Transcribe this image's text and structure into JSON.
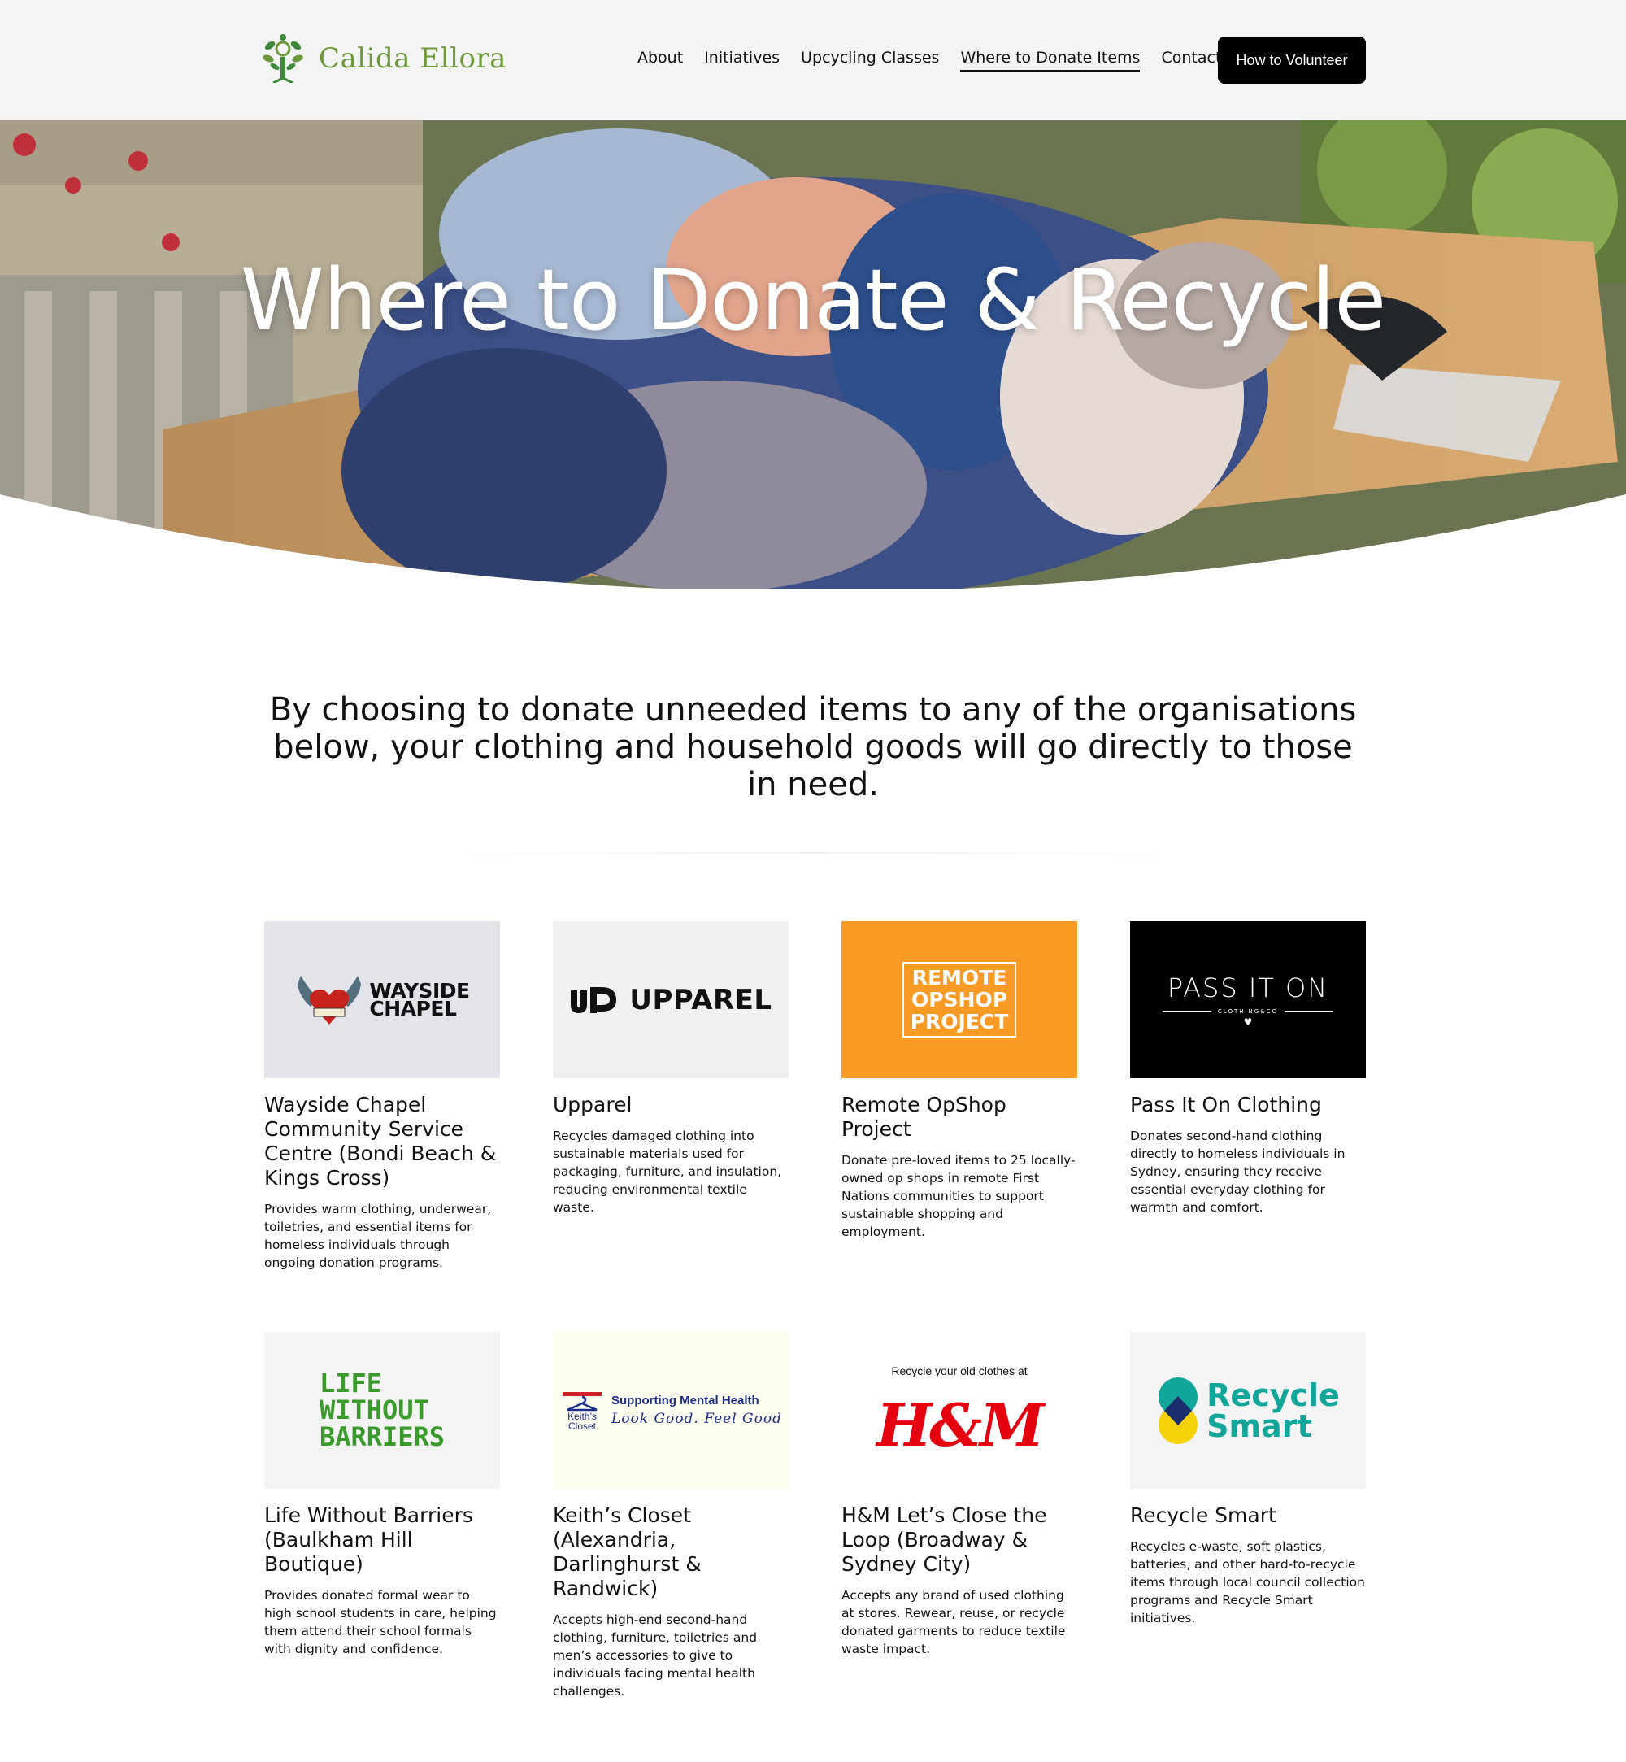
{
  "brand": {
    "name": "Calida Ellora",
    "logo_icon": "tree-icon"
  },
  "nav": {
    "items": [
      {
        "label": "About",
        "active": false
      },
      {
        "label": "Initiatives",
        "active": false
      },
      {
        "label": "Upcycling Classes",
        "active": false
      },
      {
        "label": "Where to Donate Items",
        "active": true
      },
      {
        "label": "Contact Us",
        "active": false
      }
    ],
    "cta_label": "How to Volunteer"
  },
  "hero": {
    "title": "Where to Donate & Recycle"
  },
  "intro": {
    "text": "By choosing to donate unneeded items to any of the organisations below, your clothing and household goods will go directly to those in need."
  },
  "organisations": [
    {
      "name": "Wayside Chapel Community Service Centre (Bondi Beach & Kings Cross)",
      "description": "Provides warm clothing, underwear, toiletries, and essential items for homeless individuals through ongoing donation programs.",
      "logo": {
        "line1": "WAYSIDE",
        "line2": "CHAPEL",
        "bg": "#e3e4ea"
      }
    },
    {
      "name": "Upparel",
      "description": "Recycles damaged clothing into sustainable materials used for packaging, furniture, and insulation, reducing environmental textile waste.",
      "logo": {
        "text": "UPPAREL",
        "bg": "#f0f0f0"
      }
    },
    {
      "name": "Remote OpShop Project",
      "description": "Donate pre-loved items to 25 locally-owned op shops in remote First Nations communities to support sustainable shopping and employment.",
      "logo": {
        "line1": "REMOTE",
        "line2": "OPSHOP",
        "line3": "PROJECT",
        "bg": "#f99a24"
      }
    },
    {
      "name": "Pass It On Clothing",
      "description": "Donates second-hand clothing directly to homeless individuals in Sydney, ensuring they receive essential everyday clothing for warmth and comfort.",
      "logo": {
        "text": "PASS IT ON",
        "subtext": "CLOTHING&CO",
        "bg": "#000000"
      }
    },
    {
      "name": "Life Without Barriers (Baulkham Hill Boutique)",
      "description": "Provides donated formal wear to high school students in care, helping them attend their school formals with dignity and confidence.",
      "logo": {
        "line1": "LIFE",
        "line2": "WITHOUT",
        "line3": "BARRIERS",
        "bg": "#f4f4f4",
        "color": "#3a9a2c"
      }
    },
    {
      "name": "Keith’s Closet (Alexandria, Darlinghurst & Randwick)",
      "description": "Accepts high-end second-hand clothing, furniture, toiletries and men’s accessories to give to individuals facing mental health challenges.",
      "logo": {
        "name_line1": "Keith’s",
        "name_line2": "Closet",
        "tagline": "Supporting Mental Health",
        "script": "Look Good. Feel Good",
        "bg": "#fdfdf0"
      }
    },
    {
      "name": "H&M Let’s Close the Loop (Broadway & Sydney City)",
      "description": "Accepts any brand of used clothing at stores. Rewear, reuse, or recycle donated garments to reduce textile waste impact.",
      "logo": {
        "caption": "Recycle your  old clothes at",
        "text": "H&M",
        "bg": "#ffffff",
        "color": "#e50010"
      }
    },
    {
      "name": "Recycle Smart",
      "description": "Recycles e-waste, soft plastics, batteries, and other hard-to-recycle items through local council collection programs and Recycle Smart initiatives.",
      "logo": {
        "line1": "Recycle",
        "line2": "Smart",
        "bg": "#f4f4f4",
        "color": "#12a69a"
      }
    }
  ]
}
